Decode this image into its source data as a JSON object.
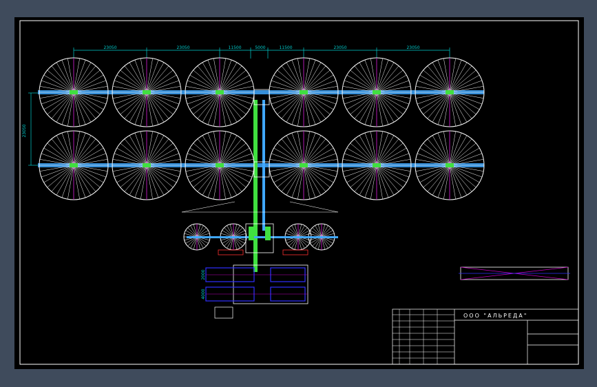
{
  "colors": {
    "background": "#000000",
    "border": "#ffffff",
    "line": "#ffffff",
    "dimension": "#00d0d0",
    "pipe": "#40a8ff",
    "channel": "#40e040",
    "label": "#ff3030",
    "axis": "#c000c0",
    "machine": "#3030ff"
  },
  "dimensions": {
    "top": [
      "23050",
      "23050",
      "11500",
      "5000",
      "11500",
      "23050",
      "23050"
    ],
    "left": "23050",
    "equipment": [
      "2000",
      "4000"
    ]
  },
  "title_block": {
    "company": "ООО \"АЛЬРЕДА\""
  }
}
